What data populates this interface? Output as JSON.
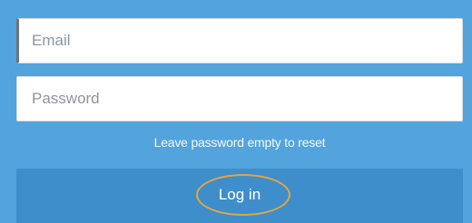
{
  "login_form": {
    "email": {
      "placeholder": "Email",
      "value": ""
    },
    "password": {
      "placeholder": "Password",
      "value": ""
    },
    "reset_hint": "Leave password empty to reset",
    "login_button_label": "Log in"
  },
  "colors": {
    "background": "#53a3dc",
    "button": "#3e8ecb",
    "highlight_ring": "#e7a43c"
  }
}
